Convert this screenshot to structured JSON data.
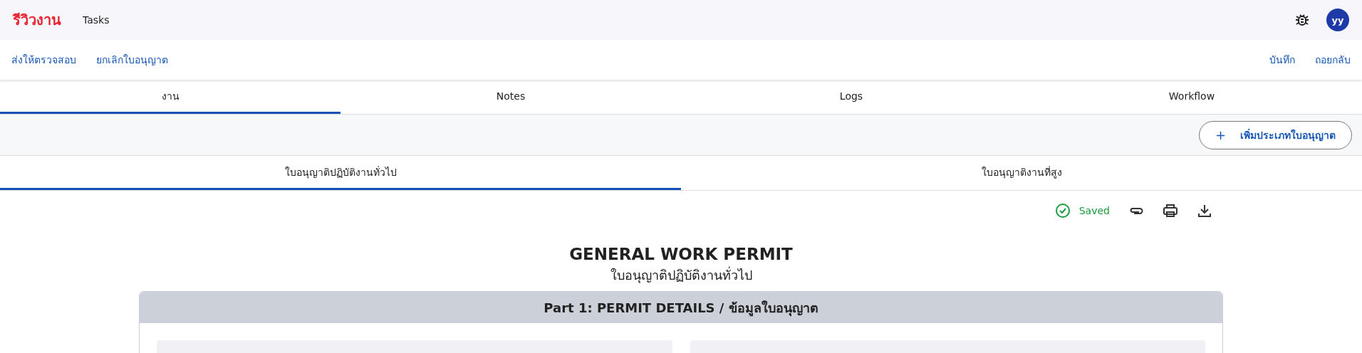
{
  "app": {
    "logo": "รีวิวงาน",
    "nav": "Tasks",
    "avatar": "yy"
  },
  "actions": {
    "left": [
      "ส่งให้ตรวจสอบ",
      "ยกเลิกใบอนุญาต"
    ],
    "right": [
      "บันทึก",
      "ถอยกลับ"
    ]
  },
  "tabs": [
    {
      "label": "งาน",
      "selected": true
    },
    {
      "label": "Notes",
      "selected": false
    },
    {
      "label": "Logs",
      "selected": false
    },
    {
      "label": "Workflow",
      "selected": false
    }
  ],
  "add_button": {
    "icon": "+",
    "label": "เพิ่มประเภทใบอนุญาต"
  },
  "permit_tabs": [
    {
      "label": "ใบอนุญาติปฏิบัติงานทั่วไป",
      "selected": true
    },
    {
      "label": "ใบอนุญาติงานที่สูง",
      "selected": false
    }
  ],
  "status": {
    "saved": true,
    "label": "Saved"
  },
  "document": {
    "title": "GENERAL WORK PERMIT",
    "subtitle": "ใบอนุญาติปฏิบัติงานทั่วไป",
    "section": "Part 1: PERMIT DETAILS / ข้อมูลใบอนุญาต"
  }
}
